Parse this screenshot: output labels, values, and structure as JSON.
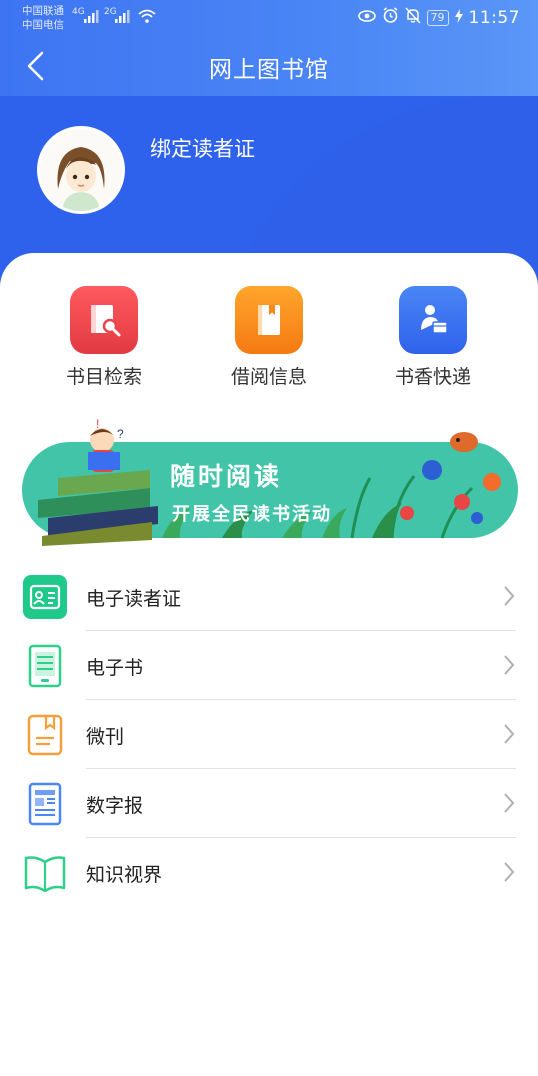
{
  "status_bar": {
    "carrier_1": "中国联通",
    "carrier_2": "中国电信",
    "net_1": "4G",
    "net_2": "2G",
    "battery": "79",
    "time": "11:57"
  },
  "nav": {
    "title": "网上图书馆"
  },
  "profile": {
    "bind_label": "绑定读者证"
  },
  "quick_actions": [
    {
      "label": "书目检索",
      "icon": "book-search-icon",
      "color": "#e8444b"
    },
    {
      "label": "借阅信息",
      "icon": "book-icon",
      "color": "#f7891c"
    },
    {
      "label": "书香快递",
      "icon": "delivery-icon",
      "color": "#3a6ff0"
    }
  ],
  "banner": {
    "title": "随时阅读",
    "subtitle": "开展全民读书活动",
    "color": "#3fc3a6"
  },
  "list": [
    {
      "label": "电子读者证",
      "icon": "reader-card-icon"
    },
    {
      "label": "电子书",
      "icon": "ebook-icon"
    },
    {
      "label": "微刊",
      "icon": "micro-journal-icon"
    },
    {
      "label": "数字报",
      "icon": "digital-newspaper-icon"
    },
    {
      "label": "知识视界",
      "icon": "open-book-icon"
    }
  ],
  "colors": {
    "primary": "#3a6ff0",
    "green": "#2ecf8a",
    "orange": "#f5a03a",
    "blue_icon": "#4a86f5"
  }
}
